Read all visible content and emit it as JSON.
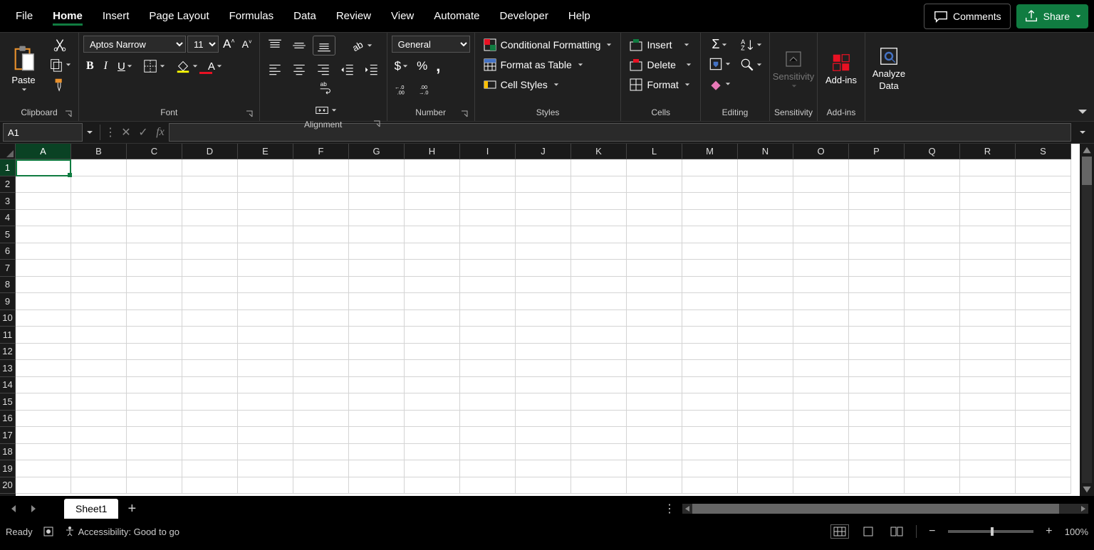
{
  "tabs": {
    "file": "File",
    "home": "Home",
    "insert": "Insert",
    "page_layout": "Page Layout",
    "formulas": "Formulas",
    "data": "Data",
    "review": "Review",
    "view": "View",
    "automate": "Automate",
    "developer": "Developer",
    "help": "Help"
  },
  "header_buttons": {
    "comments": "Comments",
    "share": "Share"
  },
  "ribbon": {
    "clipboard": {
      "paste": "Paste",
      "label": "Clipboard"
    },
    "font": {
      "name": "Aptos Narrow",
      "size": "11",
      "label": "Font"
    },
    "alignment": {
      "label": "Alignment"
    },
    "number": {
      "format": "General",
      "label": "Number"
    },
    "styles": {
      "cond": "Conditional Formatting",
      "table": "Format as Table",
      "cell": "Cell Styles",
      "label": "Styles"
    },
    "cells": {
      "insert": "Insert",
      "delete": "Delete",
      "format": "Format",
      "label": "Cells"
    },
    "editing": {
      "label": "Editing"
    },
    "sensitivity": {
      "btn": "Sensitivity",
      "label": "Sensitivity"
    },
    "addins": {
      "btn": "Add-ins",
      "label": "Add-ins"
    },
    "analyze": {
      "btn1": "Analyze",
      "btn2": "Data"
    }
  },
  "formula_bar": {
    "name_box": "A1"
  },
  "grid": {
    "columns": [
      "A",
      "B",
      "C",
      "D",
      "E",
      "F",
      "G",
      "H",
      "I",
      "J",
      "K",
      "L",
      "M",
      "N",
      "O",
      "P",
      "Q",
      "R",
      "S"
    ],
    "rows": [
      "1",
      "2",
      "3",
      "4",
      "5",
      "6",
      "7",
      "8",
      "9",
      "10",
      "11",
      "12",
      "13",
      "14",
      "15",
      "16",
      "17",
      "18",
      "19",
      "20"
    ],
    "active": "A1"
  },
  "sheet": {
    "name": "Sheet1"
  },
  "status": {
    "ready": "Ready",
    "accessibility": "Accessibility: Good to go",
    "zoom": "100%"
  }
}
